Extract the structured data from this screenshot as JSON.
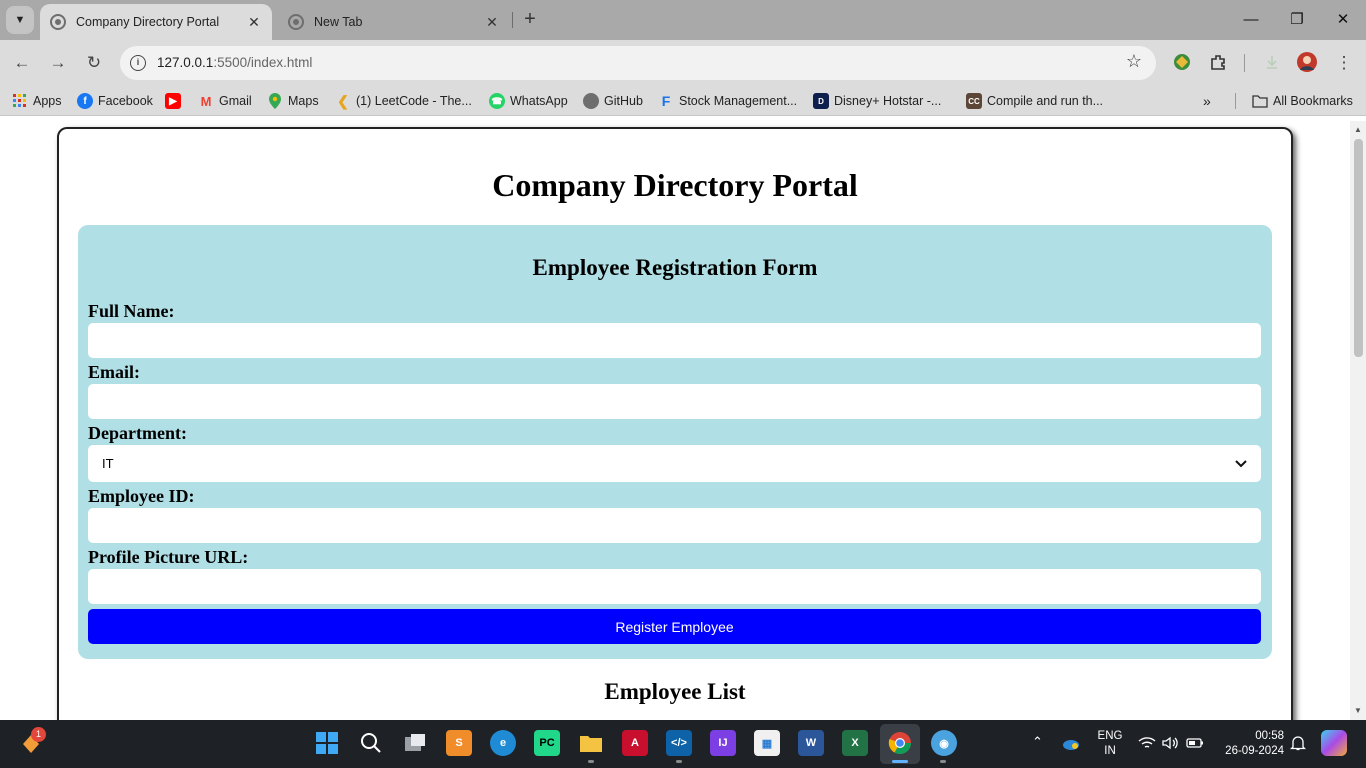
{
  "browser": {
    "tabs": [
      {
        "title": "Company Directory Portal",
        "active": true
      },
      {
        "title": "New Tab",
        "active": false
      }
    ],
    "url_host": "127.0.0.1",
    "url_rest": ":5500/index.html",
    "bookmarks": [
      {
        "label": "Apps",
        "icon": "apps-grid-icon"
      },
      {
        "label": "Facebook",
        "icon": "facebook-icon"
      },
      {
        "label": "",
        "icon": "youtube-icon"
      },
      {
        "label": "Gmail",
        "icon": "gmail-icon"
      },
      {
        "label": "Maps",
        "icon": "maps-icon"
      },
      {
        "label": "(1) LeetCode - The...",
        "icon": "leetcode-icon"
      },
      {
        "label": "WhatsApp",
        "icon": "whatsapp-icon"
      },
      {
        "label": "GitHub",
        "icon": "github-icon"
      },
      {
        "label": "Stock Management...",
        "icon": "firebase-icon"
      },
      {
        "label": "Disney+ Hotstar -...",
        "icon": "hotstar-icon"
      },
      {
        "label": "Compile and run th...",
        "icon": "codechef-icon"
      }
    ],
    "all_bookmarks": "All Bookmarks"
  },
  "page": {
    "title": "Company Directory Portal",
    "form": {
      "title": "Employee Registration Form",
      "fields": {
        "full_name": {
          "label": "Full Name:",
          "value": ""
        },
        "email": {
          "label": "Email:",
          "value": ""
        },
        "department": {
          "label": "Department:",
          "value": "IT"
        },
        "employee_id": {
          "label": "Employee ID:",
          "value": ""
        },
        "profile_url": {
          "label": "Profile Picture URL:",
          "value": ""
        }
      },
      "submit_label": "Register Employee"
    },
    "list_title": "Employee List"
  },
  "taskbar": {
    "notification_badge": "1",
    "language_line1": "ENG",
    "language_line2": "IN",
    "time": "00:58",
    "date": "26-09-2024"
  },
  "colors": {
    "form_bg": "#b0dfe5",
    "button_bg": "#0000ff",
    "tabstrip_bg": "#a9a9a9",
    "toolbar_bg": "#dcdcdc",
    "taskbar_bg": "#1e2126"
  }
}
